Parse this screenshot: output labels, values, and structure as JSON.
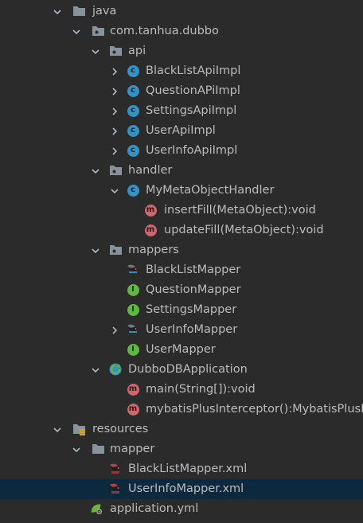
{
  "tree": {
    "nodes": [
      {
        "label": "java",
        "icon": "folder-icon",
        "arrow": "expanded"
      },
      {
        "label": "com.tanhua.dubbo",
        "icon": "package-icon",
        "arrow": "expanded"
      },
      {
        "label": "api",
        "icon": "package-icon",
        "arrow": "expanded"
      },
      {
        "label": "BlackListApiImpl",
        "icon": "class-icon",
        "arrow": "collapsed"
      },
      {
        "label": "QuestionAPiImpl",
        "icon": "class-icon",
        "arrow": "collapsed"
      },
      {
        "label": "SettingsApiImpl",
        "icon": "class-icon",
        "arrow": "collapsed"
      },
      {
        "label": "UserApiImpl",
        "icon": "class-icon",
        "arrow": "collapsed"
      },
      {
        "label": "UserInfoApiImpl",
        "icon": "class-icon",
        "arrow": "collapsed"
      },
      {
        "label": "handler",
        "icon": "package-icon",
        "arrow": "expanded"
      },
      {
        "label": "MyMetaObjectHandler",
        "icon": "class-icon",
        "arrow": "expanded"
      },
      {
        "label": "insertFill(MetaObject):void",
        "icon": "method-icon",
        "arrow": "none"
      },
      {
        "label": "updateFill(MetaObject):void",
        "icon": "method-icon",
        "arrow": "none"
      },
      {
        "label": "mappers",
        "icon": "package-icon",
        "arrow": "expanded"
      },
      {
        "label": "BlackListMapper",
        "icon": "mybatis-interface-icon",
        "arrow": "none"
      },
      {
        "label": "QuestionMapper",
        "icon": "interface-icon",
        "arrow": "none"
      },
      {
        "label": "SettingsMapper",
        "icon": "interface-icon",
        "arrow": "none"
      },
      {
        "label": "UserInfoMapper",
        "icon": "mybatis-interface-icon",
        "arrow": "collapsed"
      },
      {
        "label": "UserMapper",
        "icon": "interface-icon",
        "arrow": "none"
      },
      {
        "label": "DubboDBApplication",
        "icon": "spring-boot-class-icon",
        "arrow": "expanded"
      },
      {
        "label": "main(String[]):void",
        "icon": "method-icon",
        "arrow": "none"
      },
      {
        "label": "mybatisPlusInterceptor():MybatisPlusI",
        "icon": "method-icon",
        "arrow": "none"
      },
      {
        "label": "resources",
        "icon": "resources-folder-icon",
        "arrow": "expanded"
      },
      {
        "label": "mapper",
        "icon": "folder-icon",
        "arrow": "expanded"
      },
      {
        "label": "BlackListMapper.xml",
        "icon": "mybatis-xml-icon",
        "arrow": "none"
      },
      {
        "label": "UserInfoMapper.xml",
        "icon": "mybatis-xml-icon",
        "arrow": "none",
        "selected": true
      },
      {
        "label": "application.yml",
        "icon": "spring-yml-icon",
        "arrow": "none"
      }
    ]
  }
}
